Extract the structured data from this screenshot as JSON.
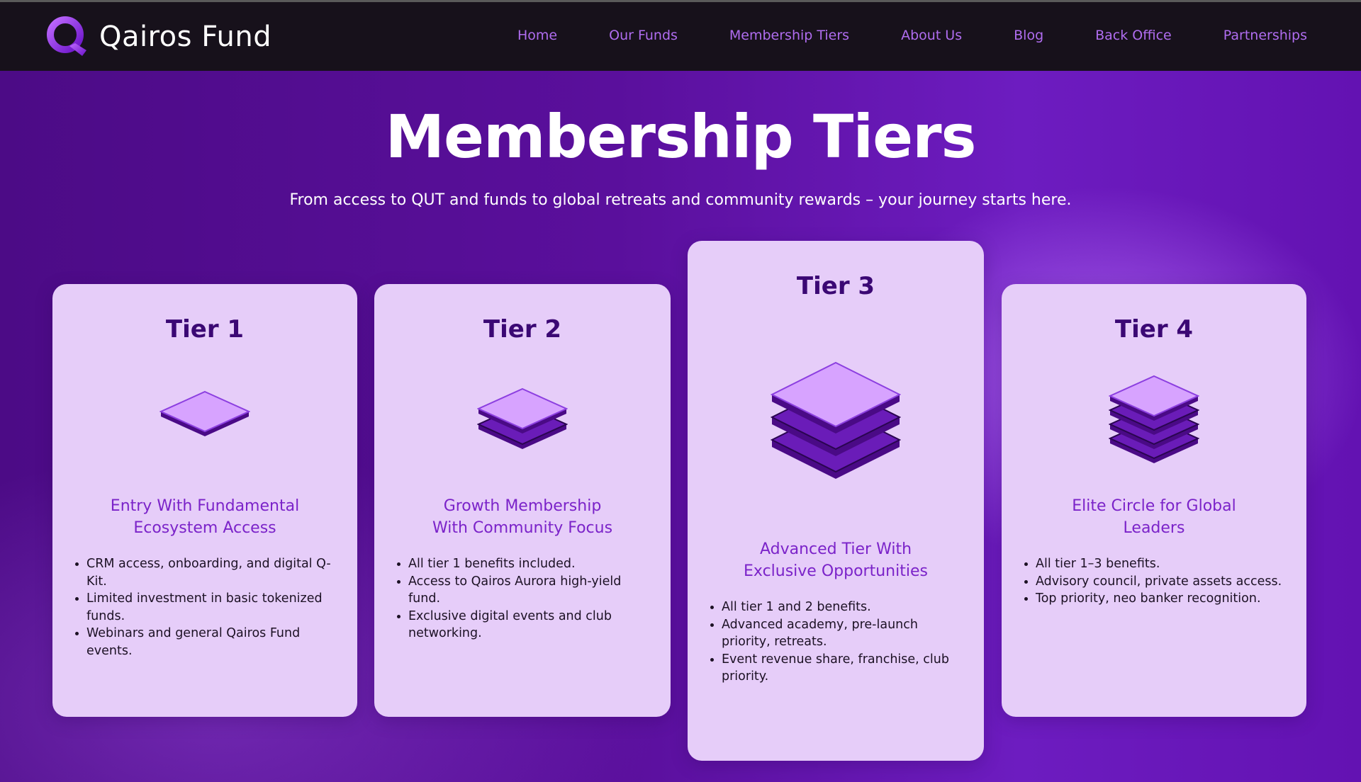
{
  "brand": {
    "name": "Qairos Fund",
    "logo_icon": "q-ring-logo"
  },
  "nav": [
    "Home",
    "Our Funds",
    "Membership Tiers",
    "About Us",
    "Blog",
    "Back Office",
    "Partnerships"
  ],
  "hero": {
    "title": "Membership Tiers",
    "subtitle": "From access to QUT and funds to global retreats and community rewards – your journey starts here."
  },
  "tiers": [
    {
      "title": "Tier 1",
      "subtitle_lines": [
        "Entry With Fundamental",
        "Ecosystem Access"
      ],
      "benefits": [
        [
          "CRM access, onboarding, and digital",
          "Q-Kit."
        ],
        [
          "Limited investment in basic tokenized",
          "funds."
        ],
        [
          "Webinars and general Qairos Fund",
          "events."
        ]
      ],
      "layers": 1
    },
    {
      "title": "Tier 2",
      "subtitle_lines": [
        "Growth Membership",
        "With Community Focus"
      ],
      "benefits": [
        [
          "All tier 1 benefits included."
        ],
        [
          "Access to Qairos Aurora high-yield",
          "fund."
        ],
        [
          "Exclusive digital events and club",
          "networking."
        ]
      ],
      "layers": 2
    },
    {
      "title": "Tier 3",
      "subtitle_lines": [
        "Advanced Tier With",
        "Exclusive Opportunities"
      ],
      "benefits": [
        [
          "All tier 1 and 2 benefits."
        ],
        [
          "Advanced academy, pre-launch",
          "priority, retreats."
        ],
        [
          "Event revenue share, franchise, club",
          "priority."
        ]
      ],
      "layers": 3
    },
    {
      "title": "Tier 4",
      "subtitle_lines": [
        "Elite Circle for Global",
        "Leaders"
      ],
      "benefits": [
        [
          "All tier 1–3 benefits."
        ],
        [
          "Advisory council, private assets",
          "access."
        ],
        [
          "Top priority, neo banker recognition."
        ]
      ],
      "layers": 4
    }
  ],
  "colors": {
    "accent": "#b06df0",
    "card_bg": "#e6cdf9",
    "tier_title": "#3b0874",
    "tier_subtitle": "#7b23c9",
    "hero_bg": "#5a0f9c"
  }
}
